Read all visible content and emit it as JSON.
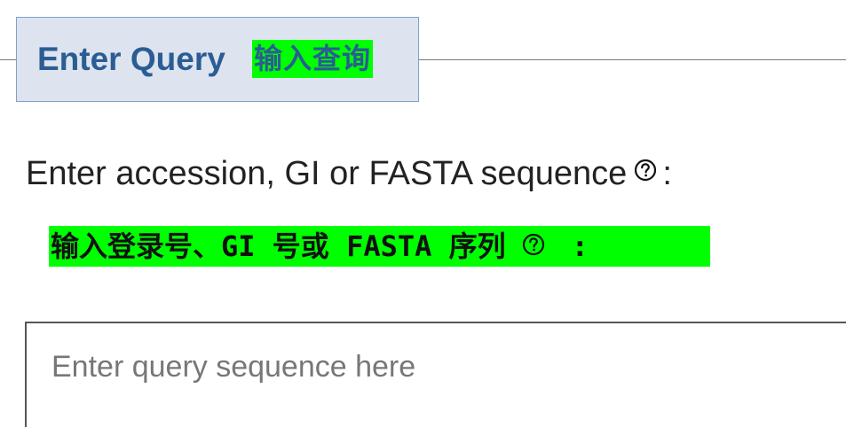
{
  "section": {
    "title": "Enter Query",
    "title_translation": "输入查询"
  },
  "query_field": {
    "label": "Enter accession, GI or FASTA sequence",
    "label_colon": ":",
    "label_translation": "输入登录号、GI 号或 FASTA 序列",
    "label_translation_colon": ":",
    "help_icon": "question-circle-icon",
    "value": "",
    "placeholder": "Enter query sequence here"
  },
  "colors": {
    "header_bg": "#dde4ef",
    "header_border": "#7fa0cc",
    "header_text": "#2b5c94",
    "highlight": "#00ff00"
  }
}
